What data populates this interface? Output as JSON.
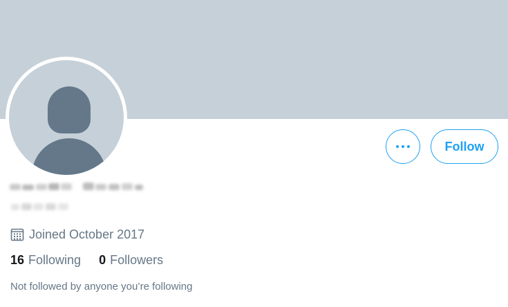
{
  "profile": {
    "display_name": "██████ █████",
    "handle": "@██████",
    "joined_text": "Joined October 2017",
    "following_count": "16",
    "following_label": "Following",
    "followers_count": "0",
    "followers_label": "Followers",
    "social_context": "Not followed by anyone you’re following"
  },
  "actions": {
    "follow_label": "Follow",
    "more_icon": "more-horizontal-icon"
  },
  "icons": {
    "calendar": "calendar-icon",
    "avatar": "default-user-avatar-icon"
  },
  "colors": {
    "banner": "#c6d0d8",
    "avatar_placeholder": "#64788a",
    "accent": "#1da1f2",
    "secondary_text": "#657786",
    "primary_text": "#14171a"
  }
}
